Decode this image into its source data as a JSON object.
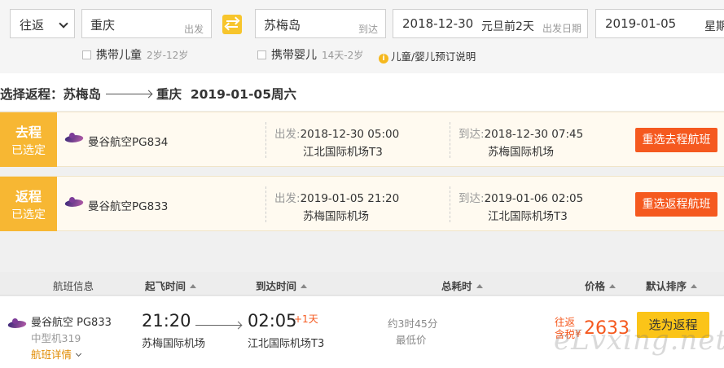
{
  "search": {
    "trip_type": "往返",
    "from_city": "重庆",
    "from_tag": "出发",
    "to_city": "苏梅岛",
    "to_tag": "到达",
    "depart_date": "2018-12-30",
    "depart_hint": "元旦前2天",
    "depart_tag": "出发日期",
    "return_date": "2019-01-05",
    "return_weekday": "星期"
  },
  "options": {
    "child_label": "携带儿童",
    "child_age": "2岁-12岁",
    "infant_label": "携带婴儿",
    "infant_age": "14天-2岁",
    "info_link": "儿童/婴儿预订说明",
    "info_icon": "i"
  },
  "heading": {
    "prefix": "选择返程：苏梅岛",
    "dest": "重庆",
    "date": "2019-01-05周六"
  },
  "segments": [
    {
      "badge_title": "去程",
      "badge_sub": "已选定",
      "flight": "曼谷航空PG834",
      "depart_label": "出发:",
      "depart_time": "2018-12-30 05:00",
      "depart_airport": "江北国际机场T3",
      "arrive_label": "到达:",
      "arrive_time": "2018-12-30 07:45",
      "arrive_airport": "苏梅国际机场",
      "reselect": "重选去程航班"
    },
    {
      "badge_title": "返程",
      "badge_sub": "已选定",
      "flight": "曼谷航空PG833",
      "depart_label": "出发:",
      "depart_time": "2019-01-05 21:20",
      "depart_airport": "苏梅国际机场",
      "arrive_label": "到达:",
      "arrive_time": "2019-01-06 02:05",
      "arrive_airport": "江北国际机场T3",
      "reselect": "重选返程航班"
    }
  ],
  "list_header": {
    "info": "航班信息",
    "depart": "起飞时间",
    "arrive": "到达时间",
    "duration": "总耗时",
    "price": "价格",
    "sort": "默认排序"
  },
  "flight_row": {
    "airline": "曼谷航空 PG833",
    "plane": "中型机319",
    "detail": "航班详情",
    "depart_time": "21:20",
    "depart_airport": "苏梅国际机场",
    "arrive_time": "02:05",
    "next_day": "+1天",
    "arrive_airport": "江北国际机场T3",
    "duration": "约3时45分",
    "lowest": "最低价",
    "price_tag_1": "往返",
    "price_tag_2": "含税",
    "currency": "¥",
    "price": "2633",
    "choose": "选为返程"
  },
  "watermark": "eLvxing.net",
  "colors": {
    "accent_orange": "#f5591f",
    "badge_yellow": "#f7b733",
    "choose_yellow": "#fbc418"
  }
}
